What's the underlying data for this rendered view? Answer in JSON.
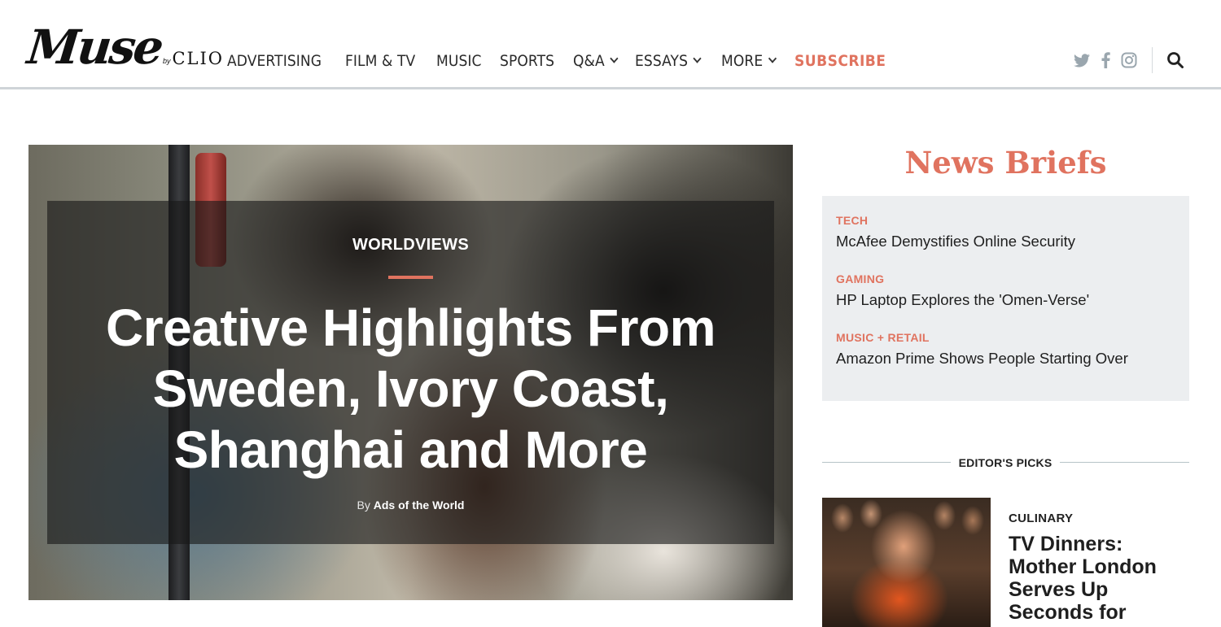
{
  "brand": {
    "logo_main": "Muse",
    "logo_by": "by",
    "logo_sub": "CLIO"
  },
  "nav": {
    "items": [
      {
        "label": "ADVERTISING",
        "dropdown": false
      },
      {
        "label": "FILM & TV",
        "dropdown": false
      },
      {
        "label": "MUSIC",
        "dropdown": false
      },
      {
        "label": "SPORTS",
        "dropdown": false
      },
      {
        "label": "Q&A",
        "dropdown": true
      },
      {
        "label": "ESSAYS",
        "dropdown": true
      },
      {
        "label": "MORE",
        "dropdown": true
      }
    ],
    "subscribe": "SUBSCRIBE"
  },
  "social": {
    "icons": [
      "twitter-icon",
      "facebook-icon",
      "instagram-icon"
    ],
    "search_icon": "search-icon"
  },
  "hero": {
    "kicker": "WORLDVIEWS",
    "title": "Creative Highlights From Sweden, Ivory Coast, Shanghai and More",
    "byline_prefix": "By",
    "byline_author": "Ads of the World"
  },
  "news_briefs": {
    "title": "News Briefs",
    "items": [
      {
        "category": "TECH",
        "headline": "McAfee Demystifies Online Security"
      },
      {
        "category": "GAMING",
        "headline": "HP Laptop Explores the 'Omen-Verse'"
      },
      {
        "category": "MUSIC + RETAIL",
        "headline": "Amazon Prime Shows People Starting Over"
      }
    ]
  },
  "editors_picks": {
    "label": "EDITOR'S PICKS",
    "item": {
      "category": "CULINARY",
      "headline": "TV Dinners: Mother London Serves Up Seconds for"
    }
  },
  "colors": {
    "accent": "#e0735f",
    "brief_bg": "#eceef0",
    "social_icon": "#9aa6ae"
  }
}
